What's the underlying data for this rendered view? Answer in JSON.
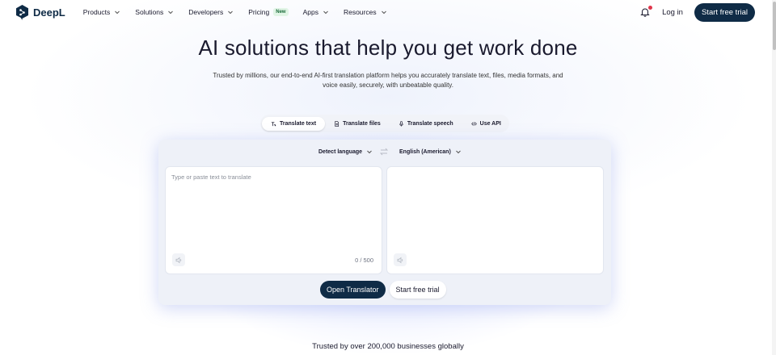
{
  "nav": {
    "logo_text": "DeepL",
    "items": [
      {
        "label": "Products",
        "has_menu": true
      },
      {
        "label": "Solutions",
        "has_menu": true
      },
      {
        "label": "Developers",
        "has_menu": true
      },
      {
        "label": "Pricing",
        "has_menu": false,
        "badge": "New"
      },
      {
        "label": "Apps",
        "has_menu": true
      },
      {
        "label": "Resources",
        "has_menu": true
      }
    ],
    "login_label": "Log in",
    "trial_label": "Start free trial"
  },
  "hero": {
    "title": "AI solutions that help you get work done",
    "subtitle": "Trusted by millions, our end-to-end AI-first translation platform helps you accurately translate text, files, media formats, and voice easily, securely, with unbeatable quality."
  },
  "tabs": [
    {
      "label": "Translate text",
      "icon": "text-icon",
      "active": true
    },
    {
      "label": "Translate files",
      "icon": "file-icon",
      "active": false
    },
    {
      "label": "Translate speech",
      "icon": "mic-icon",
      "active": false
    },
    {
      "label": "Use API",
      "icon": "code-icon",
      "active": false
    }
  ],
  "translator": {
    "source_lang": "Detect language",
    "target_lang": "English (American)",
    "input_placeholder": "Type or paste text to translate",
    "input_value": "",
    "counter": "0 / 500",
    "open_label": "Open Translator",
    "trial_label": "Start free trial"
  },
  "footer": {
    "trusted": "Trusted by over 200,000 businesses globally"
  },
  "colors": {
    "brand_dark": "#0f2b46",
    "badge_green": "#1a6b3a",
    "notification_red": "#e0354b"
  }
}
